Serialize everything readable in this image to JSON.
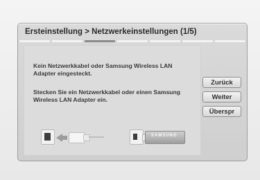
{
  "dialog": {
    "title": "Ersteinstellung > Netzwerkeinstellungen (1/5)",
    "progress": {
      "current": 1,
      "total": 5,
      "segments": 7,
      "active_segment": 2
    }
  },
  "messages": {
    "line1": "Kein Netzwerkkabel oder Samsung Wireless LAN Adapter eingesteckt.",
    "line2": "Stecken Sie ein Netzwerkkabel oder einen Samsung Wireless LAN Adapter ein."
  },
  "buttons": {
    "back": "Zurück",
    "next": "Weiter",
    "skip": "Überspr"
  },
  "illustration": {
    "dongle_brand": "SAMSUNG"
  }
}
